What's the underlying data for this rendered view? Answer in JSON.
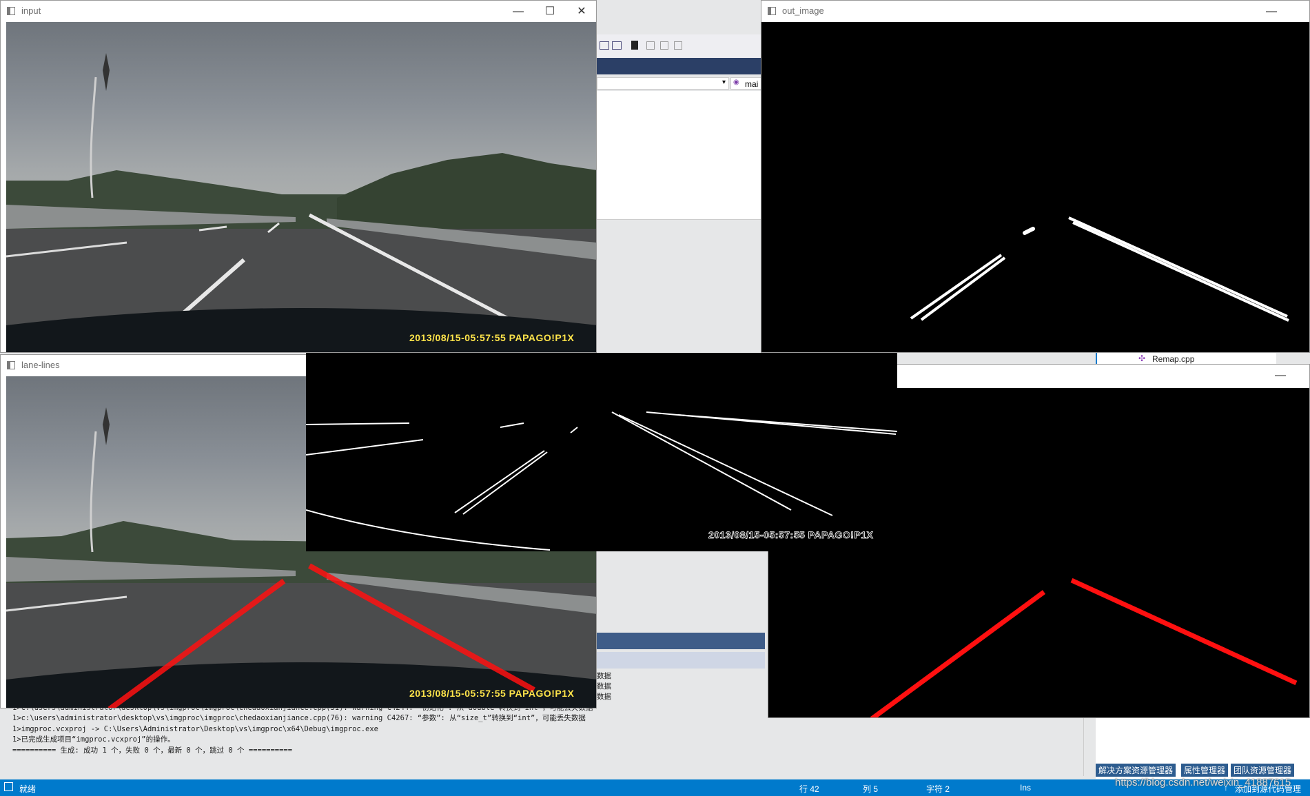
{
  "windows": {
    "input": {
      "title": "input",
      "minimize": "—",
      "maximize": "☐",
      "close": "✕",
      "timestamp": "2013/08/15-05:57:55 PAPAGO!P1X"
    },
    "out_image": {
      "title": "out_image",
      "minimize": "—"
    },
    "lane_lines": {
      "title": "lane-lines",
      "timestamp": "2013/08/15-05:57:55 PAPAGO!P1X"
    },
    "edges": {
      "timestamp": "2013/08/15-05:57:55 PAPAGO!P1X"
    },
    "lane_overlay": {
      "minimize": "—"
    }
  },
  "ide": {
    "dropdown_text": "mai",
    "file_tab": "Remap.cpp",
    "output_lines": [
      "数据",
      "数据",
      "数据",
      "1>c:\\users\\administrator\\desktop\\vs\\imgproc\\imgproc\\chedaoxianjiance.cpp(31): warning C4244: “初始化”: 从“double”转换到“int”，可能丢失数据",
      "1>c:\\users\\administrator\\desktop\\vs\\imgproc\\imgproc\\chedaoxianjiance.cpp(76): warning C4267: “参数”: 从“size_t”转换到“int”，可能丢失数据",
      "1>imgproc.vcxproj -> C:\\Users\\Administrator\\Desktop\\vs\\imgproc\\x64\\Debug\\imgproc.exe",
      "1>已完成生成项目“imgproc.vcxproj”的操作。",
      "========== 生成: 成功 1 个，失败 0 个，最新 0 个，跳过 0 个 =========="
    ],
    "panel_tabs": [
      "解决方案资源管理器",
      "属性管理器",
      "团队资源管理器"
    ],
    "status": {
      "ready": "就绪",
      "line": "行 42",
      "col": "列 5",
      "char": "字符 2",
      "mode": "Ins",
      "source_control": "添加到源代码管理"
    },
    "watermark": "https://blog.csdn.net/weixin_41887615"
  },
  "colors": {
    "lane_red": "#ff1010",
    "vs_blue": "#007acc",
    "stamp_yellow": "#ffe44a"
  }
}
